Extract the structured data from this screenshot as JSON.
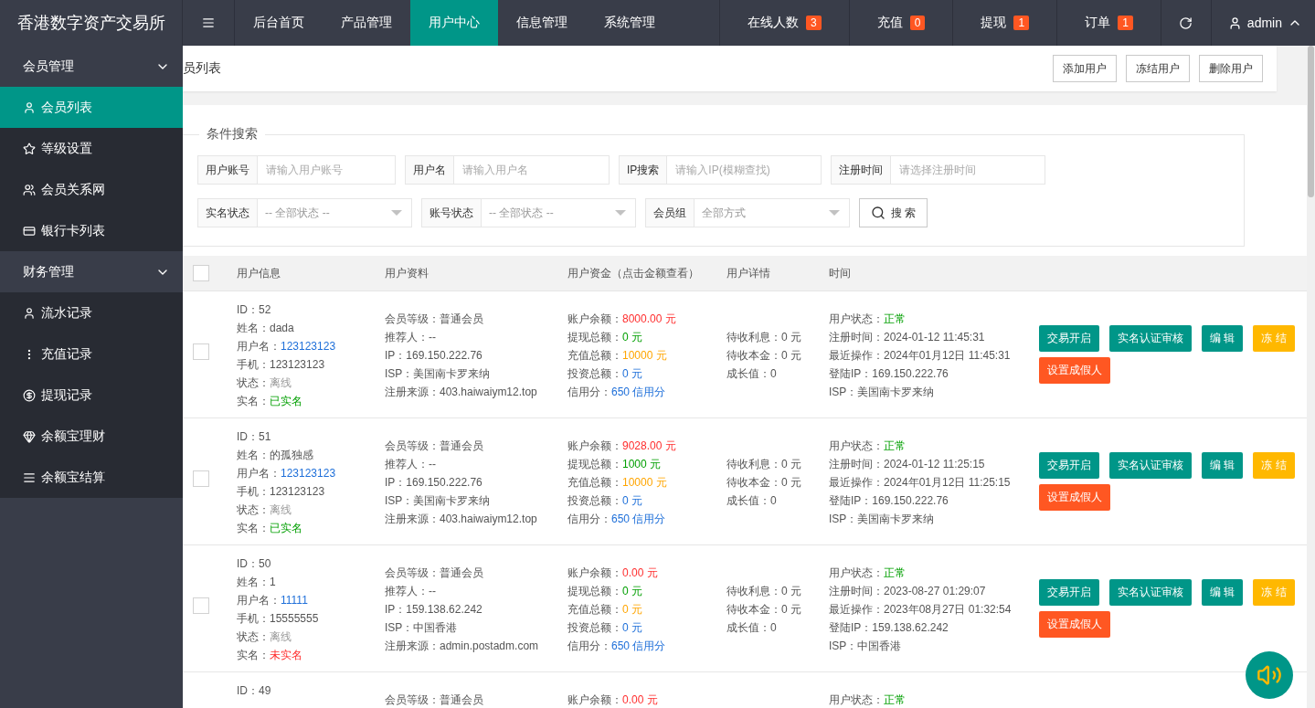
{
  "brand": "香港数字资产交易所",
  "nav": [
    {
      "label": "后台首页",
      "selected": false
    },
    {
      "label": "产品管理",
      "selected": false
    },
    {
      "label": "用户中心",
      "selected": true
    },
    {
      "label": "信息管理",
      "selected": false
    },
    {
      "label": "系统管理",
      "selected": false
    }
  ],
  "stats": [
    {
      "label": "在线人数",
      "count": "3"
    },
    {
      "label": "充值",
      "count": "0"
    },
    {
      "label": "提现",
      "count": "1"
    },
    {
      "label": "订单",
      "count": "1"
    }
  ],
  "user": "admin",
  "sidebar": [
    {
      "label": "会员管理",
      "expanded": true,
      "children": [
        {
          "label": "会员列表",
          "selected": true
        },
        {
          "label": "等级设置",
          "selected": false
        },
        {
          "label": "会员关系网",
          "selected": false
        },
        {
          "label": "银行卡列表",
          "selected": false
        }
      ]
    },
    {
      "label": "财务管理",
      "expanded": true,
      "children": [
        {
          "label": "流水记录",
          "selected": false
        },
        {
          "label": "充值记录",
          "selected": false
        },
        {
          "label": "提现记录",
          "selected": false
        },
        {
          "label": "余额宝理财",
          "selected": false
        },
        {
          "label": "余额宝结算",
          "selected": false
        }
      ]
    }
  ],
  "breadcrumb": "员列表",
  "toolbar": [
    "添加用户",
    "冻结用户",
    "删除用户"
  ],
  "search": {
    "legend": "条件搜索",
    "fields": [
      {
        "label": "用户账号",
        "placeholder": "请输入用户账号"
      },
      {
        "label": "用户名",
        "placeholder": "请输入用户名"
      },
      {
        "label": "IP搜索",
        "placeholder": "请输入IP(模糊查找)"
      },
      {
        "label": "注册时间",
        "placeholder": "请选择注册时间"
      }
    ],
    "selects": [
      {
        "label": "实名状态",
        "placeholder": "-- 全部状态 --"
      },
      {
        "label": "账号状态",
        "placeholder": "-- 全部状态 --"
      },
      {
        "label": "会员组",
        "placeholder": "全部方式"
      }
    ],
    "button": "搜 索"
  },
  "table": {
    "all_checked": false,
    "columns": [
      "用户信息",
      "用户资料",
      "用户资金（点击金额查看）",
      "用户详情",
      "时间"
    ],
    "rows": [
      {
        "checked": false,
        "info": [
          {
            "label": "ID：",
            "value": "52"
          },
          {
            "label": "姓名：",
            "value": "dada"
          },
          {
            "label": "用户名：",
            "value": "123123123",
            "kind": "link"
          },
          {
            "label": "手机：",
            "value": "123123123"
          },
          {
            "label": "状态：",
            "value": "离线",
            "kind": "muted"
          },
          {
            "label": "实名：",
            "value": "已实名",
            "kind": "ok"
          }
        ],
        "profile": [
          "会员等级：普通会员",
          "推荐人：--",
          "IP：169.150.222.76",
          "ISP：美国南卡罗来纳",
          "注册来源：403.haiwaiym12.top"
        ],
        "funds": [
          {
            "label": "账户余额：",
            "value": "8000.00 元",
            "kind": "bad"
          },
          {
            "label": "提现总额：",
            "value": "0 元",
            "kind": "ok"
          },
          {
            "label": "充值总额：",
            "value": "10000 元",
            "kind": "warn"
          },
          {
            "label": "投资总额：",
            "value": "0 元",
            "kind": "link"
          },
          {
            "label": "信用分：",
            "value": "650 信用分",
            "kind": "link"
          }
        ],
        "details": [
          "待收利息：0 元",
          "待收本金：0 元",
          "成长值：0"
        ],
        "time": [
          {
            "label": "用户状态：",
            "value": "正常",
            "kind": "ok"
          },
          {
            "label": "注册时间：",
            "value": "2024-01-12 11:45:31"
          },
          {
            "label": "最近操作：",
            "value": "2024年01月12日 11:45:31"
          },
          {
            "label": "登陆IP：",
            "value": "169.150.222.76"
          },
          {
            "label": "ISP：",
            "value": "美国南卡罗来纳"
          }
        ],
        "actions": [
          {
            "label": "交易开启",
            "kind": "primary"
          },
          {
            "label": "实名认证审核",
            "kind": "primary"
          },
          {
            "label": "编 辑",
            "kind": "primary"
          },
          {
            "label": "冻 结",
            "kind": "warn"
          },
          {
            "label": "设置成假人",
            "kind": "danger"
          }
        ]
      },
      {
        "checked": false,
        "info": [
          {
            "label": "ID：",
            "value": "51"
          },
          {
            "label": "姓名：",
            "value": "的孤独感"
          },
          {
            "label": "用户名：",
            "value": "123123123",
            "kind": "link"
          },
          {
            "label": "手机：",
            "value": "123123123"
          },
          {
            "label": "状态：",
            "value": "离线",
            "kind": "muted"
          },
          {
            "label": "实名：",
            "value": "已实名",
            "kind": "ok"
          }
        ],
        "profile": [
          "会员等级：普通会员",
          "推荐人：--",
          "IP：169.150.222.76",
          "ISP：美国南卡罗来纳",
          "注册来源：403.haiwaiym12.top"
        ],
        "funds": [
          {
            "label": "账户余额：",
            "value": "9028.00 元",
            "kind": "bad"
          },
          {
            "label": "提现总额：",
            "value": "1000 元",
            "kind": "ok"
          },
          {
            "label": "充值总额：",
            "value": "10000 元",
            "kind": "warn"
          },
          {
            "label": "投资总额：",
            "value": "0 元",
            "kind": "link"
          },
          {
            "label": "信用分：",
            "value": "650 信用分",
            "kind": "link"
          }
        ],
        "details": [
          "待收利息：0 元",
          "待收本金：0 元",
          "成长值：0"
        ],
        "time": [
          {
            "label": "用户状态：",
            "value": "正常",
            "kind": "ok"
          },
          {
            "label": "注册时间：",
            "value": "2024-01-12 11:25:15"
          },
          {
            "label": "最近操作：",
            "value": "2024年01月12日 11:25:15"
          },
          {
            "label": "登陆IP：",
            "value": "169.150.222.76"
          },
          {
            "label": "ISP：",
            "value": "美国南卡罗来纳"
          }
        ],
        "actions": [
          {
            "label": "交易开启",
            "kind": "primary"
          },
          {
            "label": "实名认证审核",
            "kind": "primary"
          },
          {
            "label": "编 辑",
            "kind": "primary"
          },
          {
            "label": "冻 结",
            "kind": "warn"
          },
          {
            "label": "设置成假人",
            "kind": "danger"
          }
        ]
      },
      {
        "checked": false,
        "info": [
          {
            "label": "ID：",
            "value": "50"
          },
          {
            "label": "姓名：",
            "value": "1"
          },
          {
            "label": "用户名：",
            "value": "11111",
            "kind": "link"
          },
          {
            "label": "手机：",
            "value": "15555555"
          },
          {
            "label": "状态：",
            "value": "离线",
            "kind": "muted"
          },
          {
            "label": "实名：",
            "value": "未实名",
            "kind": "bad"
          }
        ],
        "profile": [
          "会员等级：普通会员",
          "推荐人：--",
          "IP：159.138.62.242",
          "ISP：中国香港",
          "注册来源：admin.postadm.com"
        ],
        "funds": [
          {
            "label": "账户余额：",
            "value": "0.00 元",
            "kind": "bad"
          },
          {
            "label": "提现总额：",
            "value": "0 元",
            "kind": "ok"
          },
          {
            "label": "充值总额：",
            "value": "0 元",
            "kind": "warn"
          },
          {
            "label": "投资总额：",
            "value": "0 元",
            "kind": "link"
          },
          {
            "label": "信用分：",
            "value": "650 信用分",
            "kind": "link"
          }
        ],
        "details": [
          "待收利息：0 元",
          "待收本金：0 元",
          "成长值：0"
        ],
        "time": [
          {
            "label": "用户状态：",
            "value": "正常",
            "kind": "ok"
          },
          {
            "label": "注册时间：",
            "value": "2023-08-27 01:29:07"
          },
          {
            "label": "最近操作：",
            "value": "2023年08月27日 01:32:54"
          },
          {
            "label": "登陆IP：",
            "value": "159.138.62.242"
          },
          {
            "label": "ISP：",
            "value": "中国香港"
          }
        ],
        "actions": [
          {
            "label": "交易开启",
            "kind": "primary"
          },
          {
            "label": "实名认证审核",
            "kind": "primary"
          },
          {
            "label": "编 辑",
            "kind": "primary"
          },
          {
            "label": "冻 结",
            "kind": "warn"
          },
          {
            "label": "设置成假人",
            "kind": "danger"
          }
        ]
      },
      {
        "info": [
          {
            "label": "ID：",
            "value": "49"
          }
        ],
        "profile": [
          "会员等级：普通会员"
        ],
        "funds": [
          {
            "label": "账户余额：",
            "value": "0.00 元",
            "kind": "bad"
          }
        ],
        "time": [
          {
            "label": "用户状态：",
            "value": "正常",
            "kind": "ok"
          }
        ]
      }
    ]
  }
}
